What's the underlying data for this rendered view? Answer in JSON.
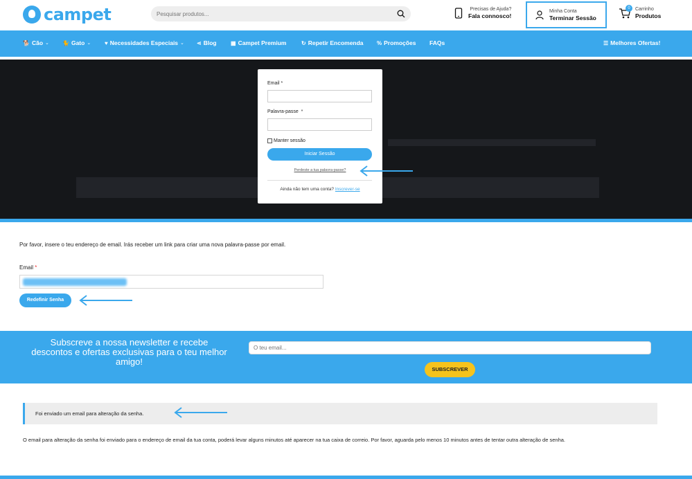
{
  "header": {
    "brand": "campet",
    "search_placeholder": "Pesquisar produtos...",
    "help": {
      "top": "Precisas de Ajuda?",
      "bottom": "Fala connosco!"
    },
    "account": {
      "top": "Minha Conta",
      "bottom": "Terminar Sessão"
    },
    "cart": {
      "top": "Carrinho",
      "bottom": "Produtos",
      "count": "0"
    }
  },
  "nav": {
    "items": [
      {
        "label": "Cão"
      },
      {
        "label": "Gato"
      },
      {
        "label": "Necessidades Especiais"
      },
      {
        "label": "Blog"
      },
      {
        "label": "Campet Premium"
      },
      {
        "label": "Repetir Encomenda"
      },
      {
        "label": "Promoções"
      },
      {
        "label": "FAQs"
      }
    ],
    "best_offers": "Melhores Ofertas!"
  },
  "login": {
    "email_label": "Email",
    "password_label": "Palavra-passe",
    "required_mark": "*",
    "remember": "Manter sessão",
    "submit": "Iniciar Sessão",
    "forgot": "Perdeste a tua palavra-passe?",
    "no_account": "Ainda não tem uma conta?",
    "register": "Inscrever-se"
  },
  "reset": {
    "instruction": "Por favor, insere o teu endereço de email. Irás receber um link para criar uma nova palavra-passe por email.",
    "email_label": "Email",
    "required_mark": "*",
    "button": "Redefinir Senha"
  },
  "newsletter": {
    "text": "Subscreve a nossa newsletter e recebe descontos e ofertas exclusivas para o teu melhor amigo!",
    "placeholder": "O teu email...",
    "button": "SUBSCREVER"
  },
  "message": {
    "notice": "Foi enviado um email para alteração da senha.",
    "detail": "O email para alteração da senha foi enviado para o endereço de email da tua conta, poderá levar alguns minutos até aparecer na tua caixa de correio. Por favor, aguarda pelo menos 10 minutos antes de tentar outra alteração de senha."
  },
  "colors": {
    "brand": "#3aa8ec",
    "accent": "#f6c31c"
  }
}
